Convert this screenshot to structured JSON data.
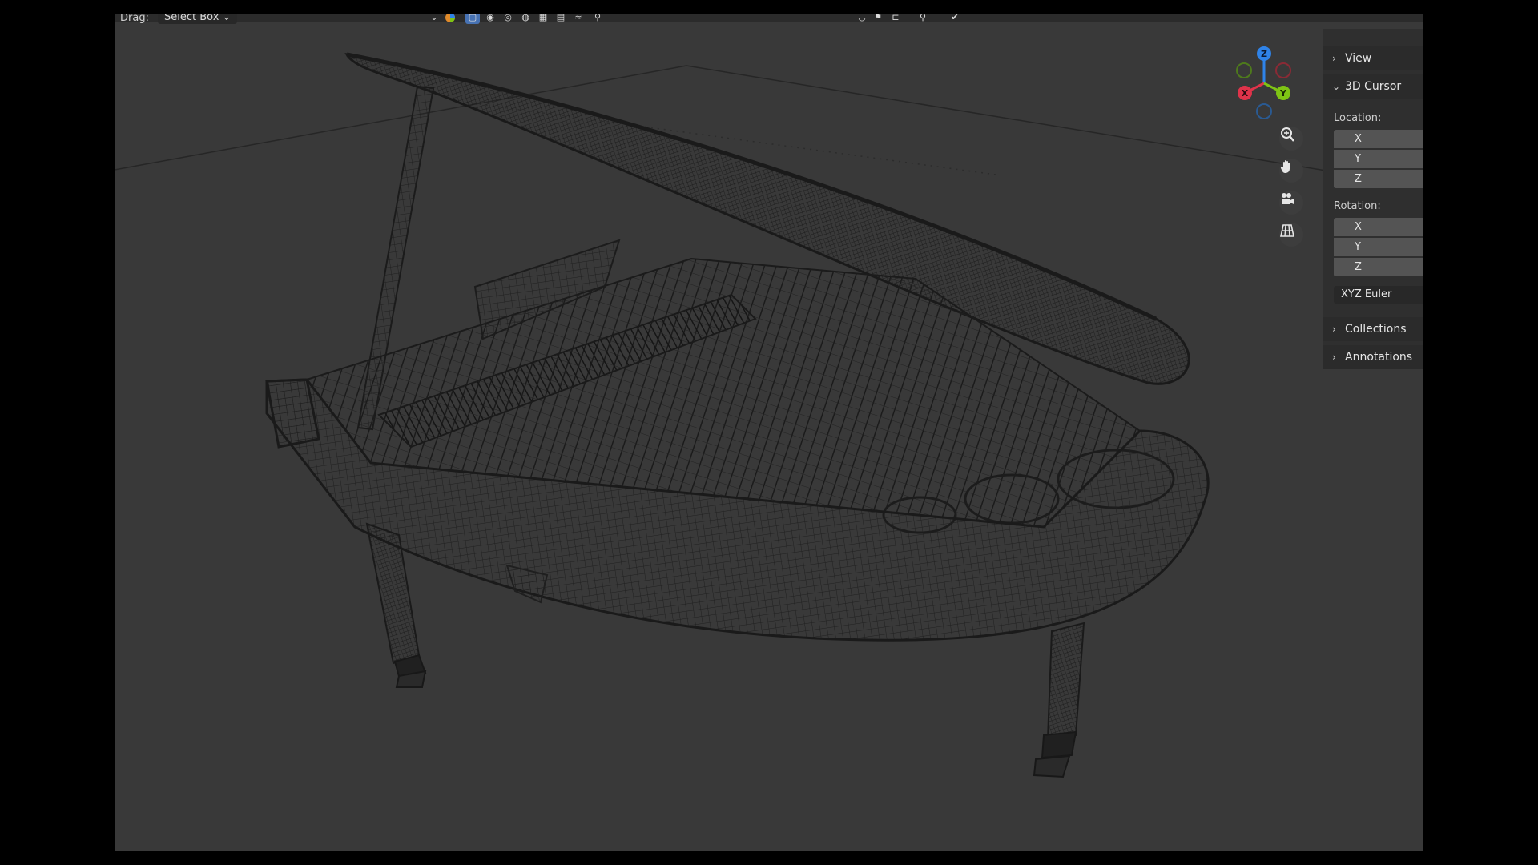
{
  "header": {
    "drag_label": "Drag:",
    "drag_mode": "Select Box",
    "drag_mode_chevron": "⌄"
  },
  "gizmo": {
    "z_label": "Z",
    "x_label": "X",
    "y_label": "Y",
    "colors": {
      "x": "#e0334a",
      "y": "#7ec414",
      "z": "#2f83e8",
      "neg_x": "#8a2a35",
      "neg_y": "#4e7a1c",
      "neg_z": "#2a5a92"
    }
  },
  "nav_tools": [
    "zoom-icon",
    "hand-pan-icon",
    "camera-icon",
    "grid-ortho-icon"
  ],
  "sidebar": {
    "view_label": "View",
    "cursor_label": "3D Cursor",
    "location_label": "Location:",
    "location_axes": [
      "X",
      "Y",
      "Z"
    ],
    "rotation_label": "Rotation:",
    "rotation_axes": [
      "X",
      "Y",
      "Z"
    ],
    "rotation_mode": "XYZ Euler",
    "collections_label": "Collections",
    "annotations_label": "Annotations"
  },
  "colors": {
    "viewport_bg": "#393939",
    "wire": "#1f1f1f",
    "panel_bg": "#2f2f2f",
    "field_bg": "#545454"
  }
}
